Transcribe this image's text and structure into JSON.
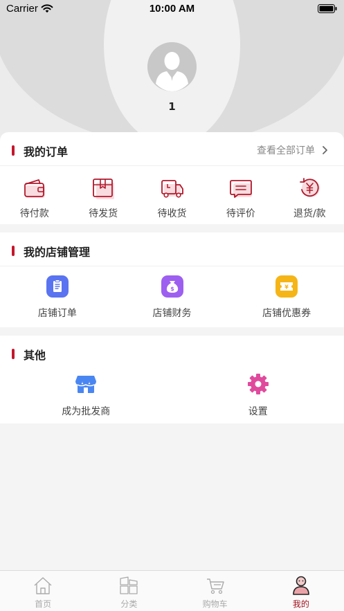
{
  "status_bar": {
    "carrier": "Carrier",
    "time": "10:00 AM"
  },
  "profile": {
    "username": "1"
  },
  "orders": {
    "title": "我的订单",
    "view_all": "查看全部订单",
    "items": [
      {
        "label": "待付款",
        "icon": "wallet-icon"
      },
      {
        "label": "待发货",
        "icon": "package-icon"
      },
      {
        "label": "待收货",
        "icon": "delivery-truck-icon"
      },
      {
        "label": "待评价",
        "icon": "comment-icon"
      },
      {
        "label": "退货/款",
        "icon": "refund-icon"
      }
    ]
  },
  "shop": {
    "title": "我的店铺管理",
    "items": [
      {
        "label": "店铺订单",
        "icon": "clipboard-icon"
      },
      {
        "label": "店铺财务",
        "icon": "money-bag-icon"
      },
      {
        "label": "店铺优惠券",
        "icon": "coupon-icon"
      }
    ]
  },
  "other": {
    "title": "其他",
    "items": [
      {
        "label": "成为批发商",
        "icon": "storefront-icon"
      },
      {
        "label": "设置",
        "icon": "gear-icon"
      }
    ]
  },
  "tabbar": {
    "items": [
      {
        "label": "首页",
        "icon": "home-icon"
      },
      {
        "label": "分类",
        "icon": "category-icon"
      },
      {
        "label": "购物车",
        "icon": "cart-icon"
      },
      {
        "label": "我的",
        "icon": "profile-icon"
      }
    ],
    "active": "我的"
  },
  "colors": {
    "accent": "#c3172d",
    "tab_active": "#a3121f",
    "clipboard_icon_bg": "#5a73f0",
    "money_icon_bg": "#9d5ff0",
    "coupon_icon_bg": "#f5b517",
    "storefront_icon": "#4a86f2",
    "gear_icon": "#e04a9d"
  }
}
